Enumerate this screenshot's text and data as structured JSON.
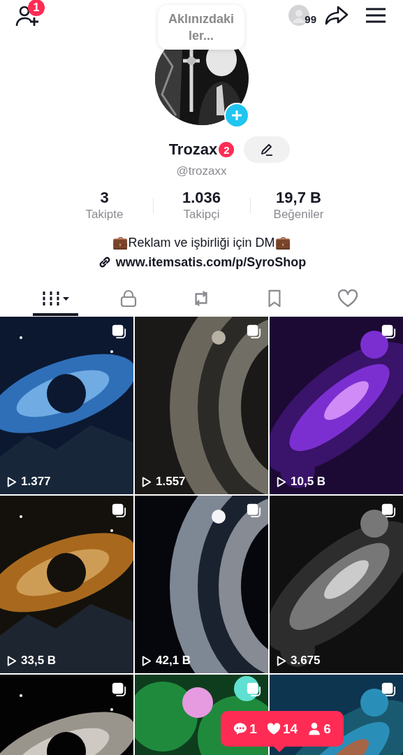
{
  "top_bar": {
    "add_friends_badge": "1",
    "visitors_count": "99"
  },
  "note_bubble": {
    "lines": [
      "Aklınızdaki",
      "ler..."
    ]
  },
  "profile": {
    "name": "Trozax",
    "name_badge": "2",
    "handle": "@trozaxx"
  },
  "stats": [
    {
      "value": "3",
      "label": "Takipte"
    },
    {
      "value": "1.036",
      "label": "Takipçi"
    },
    {
      "value": "19,7 B",
      "label": "Beğeniler"
    }
  ],
  "bio": "💼Reklam ve işbirliği için DM💼",
  "link": "www.itemsatis.com/p/SyroShop",
  "tabs": [
    {
      "kind": "videos",
      "selected": true
    },
    {
      "kind": "private",
      "selected": false
    },
    {
      "kind": "reposts",
      "selected": false
    },
    {
      "kind": "saved",
      "selected": false
    },
    {
      "kind": "liked",
      "selected": false
    }
  ],
  "videos": [
    {
      "kind": "picture",
      "views": "1.377"
    },
    {
      "kind": "picture",
      "views": "1.557"
    },
    {
      "kind": "picture",
      "views": "10,5 B"
    },
    {
      "kind": "picture",
      "views": "33,5 B"
    },
    {
      "kind": "picture",
      "views": "42,1 B"
    },
    {
      "kind": "picture",
      "views": "3.675"
    },
    {
      "kind": "picture"
    },
    {
      "kind": "picture"
    },
    {
      "kind": "picture"
    }
  ],
  "activity_popup": {
    "comments": "1",
    "likes": "14",
    "followers": "6"
  }
}
